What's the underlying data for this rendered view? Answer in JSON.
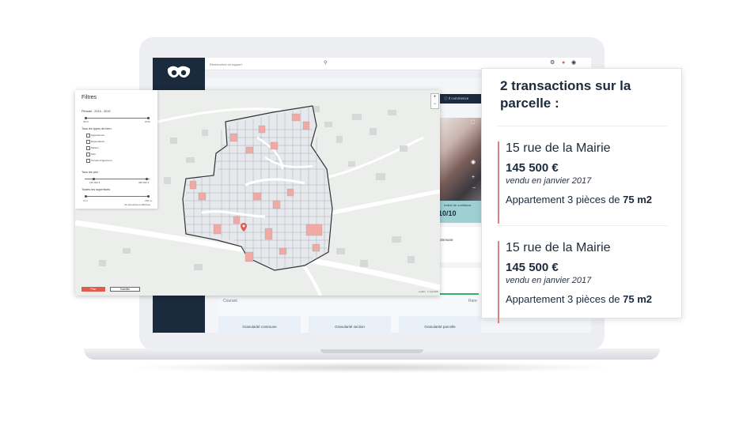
{
  "app": {
    "search_placeholder": "Recherchez un rapport",
    "icons": [
      "settings-icon",
      "notification-icon",
      "user-icon"
    ],
    "inner_header": "Il commence",
    "confidence_label": "Indice de confiance",
    "confidence_value": "10/10",
    "commune_label": "ommune",
    "scale_left": "Courant",
    "scale_right": "Rare",
    "granularity": [
      {
        "label": "Granularité commune"
      },
      {
        "label": "Granularité section"
      },
      {
        "label": "Granularité parcelle"
      }
    ]
  },
  "filters": {
    "title": "Filtres",
    "period_label": "Période : 2014 - 2019",
    "period_min": "2014",
    "period_max": "2019",
    "types_label": "Tous les types de bien",
    "types": [
      "Appartement",
      "Dépendance",
      "Maison",
      "Sols",
      "Terrains d'agrément"
    ],
    "price_label": "Tous les prix",
    "price_min": "145 000 €",
    "price_max": "385 000 €",
    "area_label": "Toutes les superficies",
    "area_min": "0 m²",
    "area_max": "248 m²",
    "area_note": "42 transactions affichées",
    "btn_primary": "Plan",
    "btn_secondary": "Satellite",
    "attribution": "Leaflet · © CartoDB"
  },
  "card": {
    "title": "2 transactions sur la parcelle :",
    "transactions": [
      {
        "address": "15 rue de la Mairie",
        "price": "145 500 €",
        "date": "vendu en janvier 2017",
        "desc_prefix": "Appartement 3 pièces de ",
        "surface": "75 m2"
      },
      {
        "address": "15 rue de la Mairie",
        "price": "145 500 €",
        "date": "vendu en janvier 2017",
        "desc_prefix": "Appartement 3 pièces de ",
        "surface": "75 m2"
      }
    ]
  },
  "colors": {
    "navy": "#1c2a3d",
    "accent_red": "#e25b4f",
    "parcel_red": "#f0a9a4",
    "confidence_teal": "#9ed0d3"
  }
}
